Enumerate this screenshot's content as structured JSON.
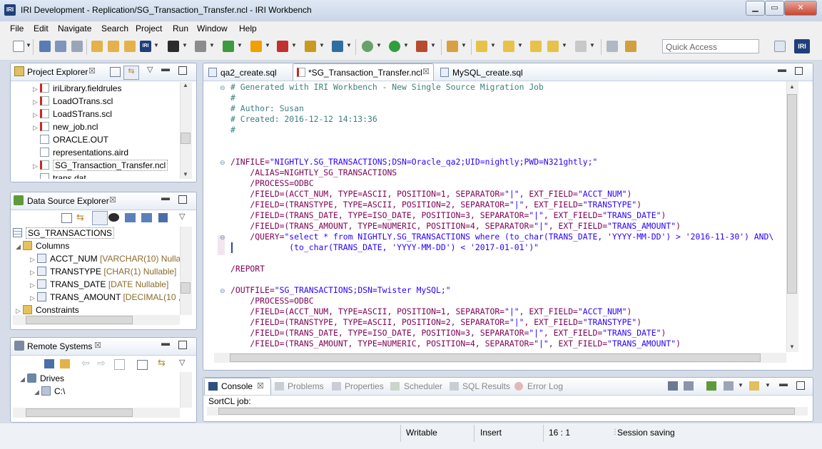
{
  "window": {
    "title": "IRI Development - Replication/SG_Transaction_Transfer.ncl - IRI Workbench",
    "app_icon_text": "IRI",
    "minimize": "▁",
    "maximize": "▭",
    "close": "✕"
  },
  "menu": [
    "File",
    "Edit",
    "Navigate",
    "Search",
    "Project",
    "Run",
    "Window",
    "Help"
  ],
  "toolbar": {
    "quick_access_placeholder": "Quick Access",
    "perspective_label": "IRI"
  },
  "project_explorer": {
    "title": "Project Explorer",
    "items": [
      {
        "label": "iriLibrary.fieldrules",
        "icon": "scl-file-icon"
      },
      {
        "label": "LoadOTrans.scl",
        "icon": "scl-file-icon"
      },
      {
        "label": "LoadSTrans.scl",
        "icon": "scl-file-icon"
      },
      {
        "label": "new_job.ncl",
        "icon": "scl-file-icon"
      },
      {
        "label": "ORACLE.OUT",
        "icon": "file-icon"
      },
      {
        "label": "representations.aird",
        "icon": "file-icon"
      },
      {
        "label": "SG_Transaction_Transfer.ncl",
        "icon": "scl-file-icon"
      },
      {
        "label": "trans.dat",
        "icon": "file-icon"
      }
    ]
  },
  "data_source_explorer": {
    "title": "Data Source Explorer",
    "table": "SG_TRANSACTIONS",
    "columns_label": "Columns",
    "columns": [
      {
        "name": "ACCT_NUM",
        "type": "[VARCHAR(10) Nulla"
      },
      {
        "name": "TRANSTYPE",
        "type": "[CHAR(1) Nullable]"
      },
      {
        "name": "TRANS_DATE",
        "type": "[DATE Nullable]"
      },
      {
        "name": "TRANS_AMOUNT",
        "type": "[DECIMAL(10 ,"
      }
    ],
    "constraints_label": "Constraints"
  },
  "remote_systems": {
    "title": "Remote Systems",
    "drives_label": "Drives",
    "drive_c": "C:\\"
  },
  "editor": {
    "tabs": [
      {
        "label": "qa2_create.sql",
        "active": false
      },
      {
        "label": "*SG_Transaction_Transfer.ncl",
        "active": true
      },
      {
        "label": "MySQL_create.sql",
        "active": false
      }
    ],
    "lines": [
      {
        "fold": "⊖",
        "text": "# Generated with IRI Workbench - New Single Source Migration Job",
        "kind": "comment"
      },
      {
        "fold": "",
        "text": "#",
        "kind": "comment"
      },
      {
        "fold": "",
        "text": "# Author: Susan",
        "kind": "comment"
      },
      {
        "fold": "",
        "text": "# Created: 2016-12-12 14:13:36",
        "kind": "comment"
      },
      {
        "fold": "",
        "text": "#",
        "kind": "comment"
      },
      {
        "fold": "",
        "text": "",
        "kind": "plain"
      },
      {
        "fold": "",
        "text": "",
        "kind": "plain"
      },
      {
        "fold": "⊖",
        "text": "/INFILE=\"NIGHTLY.SG_TRANSACTIONS;DSN=Oracle_qa2;UID=nightly;PWD=N321ghtly;\"",
        "kind": "kv"
      },
      {
        "fold": "",
        "text": "    /ALIAS=NIGHTLY_SG_TRANSACTIONS",
        "kind": "kv"
      },
      {
        "fold": "",
        "text": "    /PROCESS=ODBC",
        "kind": "kv"
      },
      {
        "fold": "",
        "text": "    /FIELD=(ACCT_NUM, TYPE=ASCII, POSITION=1, SEPARATOR=\"|\", EXT_FIELD=\"ACCT_NUM\")",
        "kind": "kv"
      },
      {
        "fold": "",
        "text": "    /FIELD=(TRANSTYPE, TYPE=ASCII, POSITION=2, SEPARATOR=\"|\", EXT_FIELD=\"TRANSTYPE\")",
        "kind": "kv"
      },
      {
        "fold": "",
        "text": "    /FIELD=(TRANS_DATE, TYPE=ISO_DATE, POSITION=3, SEPARATOR=\"|\", EXT_FIELD=\"TRANS_DATE\")",
        "kind": "kv"
      },
      {
        "fold": "",
        "text": "    /FIELD=(TRANS_AMOUNT, TYPE=NUMERIC, POSITION=4, SEPARATOR=\"|\", EXT_FIELD=\"TRANS_AMOUNT\")",
        "kind": "kv"
      },
      {
        "fold": "⊖",
        "text": "    /QUERY=\"select * from NIGHTLY.SG_TRANSACTIONS where (to_char(TRANS_DATE, 'YYYY-MM-DD') > '2016-11-30') AND\\",
        "kind": "kv"
      },
      {
        "fold": "",
        "text": "            (to_char(TRANS_DATE, 'YYYY-MM-DD') < '2017-01-01')\"",
        "kind": "str"
      },
      {
        "fold": "",
        "text": "",
        "kind": "plain"
      },
      {
        "fold": "",
        "text": "/REPORT",
        "kind": "kv"
      },
      {
        "fold": "",
        "text": "",
        "kind": "plain"
      },
      {
        "fold": "⊖",
        "text": "/OUTFILE=\"SG_TRANSACTIONS;DSN=Twister MySQL;\"",
        "kind": "kv"
      },
      {
        "fold": "",
        "text": "    /PROCESS=ODBC",
        "kind": "kv"
      },
      {
        "fold": "",
        "text": "    /FIELD=(ACCT_NUM, TYPE=ASCII, POSITION=1, SEPARATOR=\"|\", EXT_FIELD=\"ACCT_NUM\")",
        "kind": "kv"
      },
      {
        "fold": "",
        "text": "    /FIELD=(TRANSTYPE, TYPE=ASCII, POSITION=2, SEPARATOR=\"|\", EXT_FIELD=\"TRANSTYPE\")",
        "kind": "kv"
      },
      {
        "fold": "",
        "text": "    /FIELD=(TRANS_DATE, TYPE=ISO_DATE, POSITION=3, SEPARATOR=\"|\", EXT_FIELD=\"TRANS_DATE\")",
        "kind": "kv"
      },
      {
        "fold": "",
        "text": "    /FIELD=(TRANS_AMOUNT, TYPE=NUMERIC, POSITION=4, SEPARATOR=\"|\", EXT_FIELD=\"TRANS_AMOUNT\")",
        "kind": "kv"
      }
    ]
  },
  "bottom_panel": {
    "tabs": [
      "Console",
      "Problems",
      "Properties",
      "Scheduler",
      "SQL Results",
      "Error Log"
    ],
    "console_text": "SortCL job:"
  },
  "status": {
    "writable": "Writable",
    "insert_mode": "Insert",
    "position": "16 : 1",
    "session": "Session saving"
  },
  "colors": {
    "comment": "#3f7f7f",
    "keyword": "#7f0055",
    "string": "#2a00ff"
  }
}
